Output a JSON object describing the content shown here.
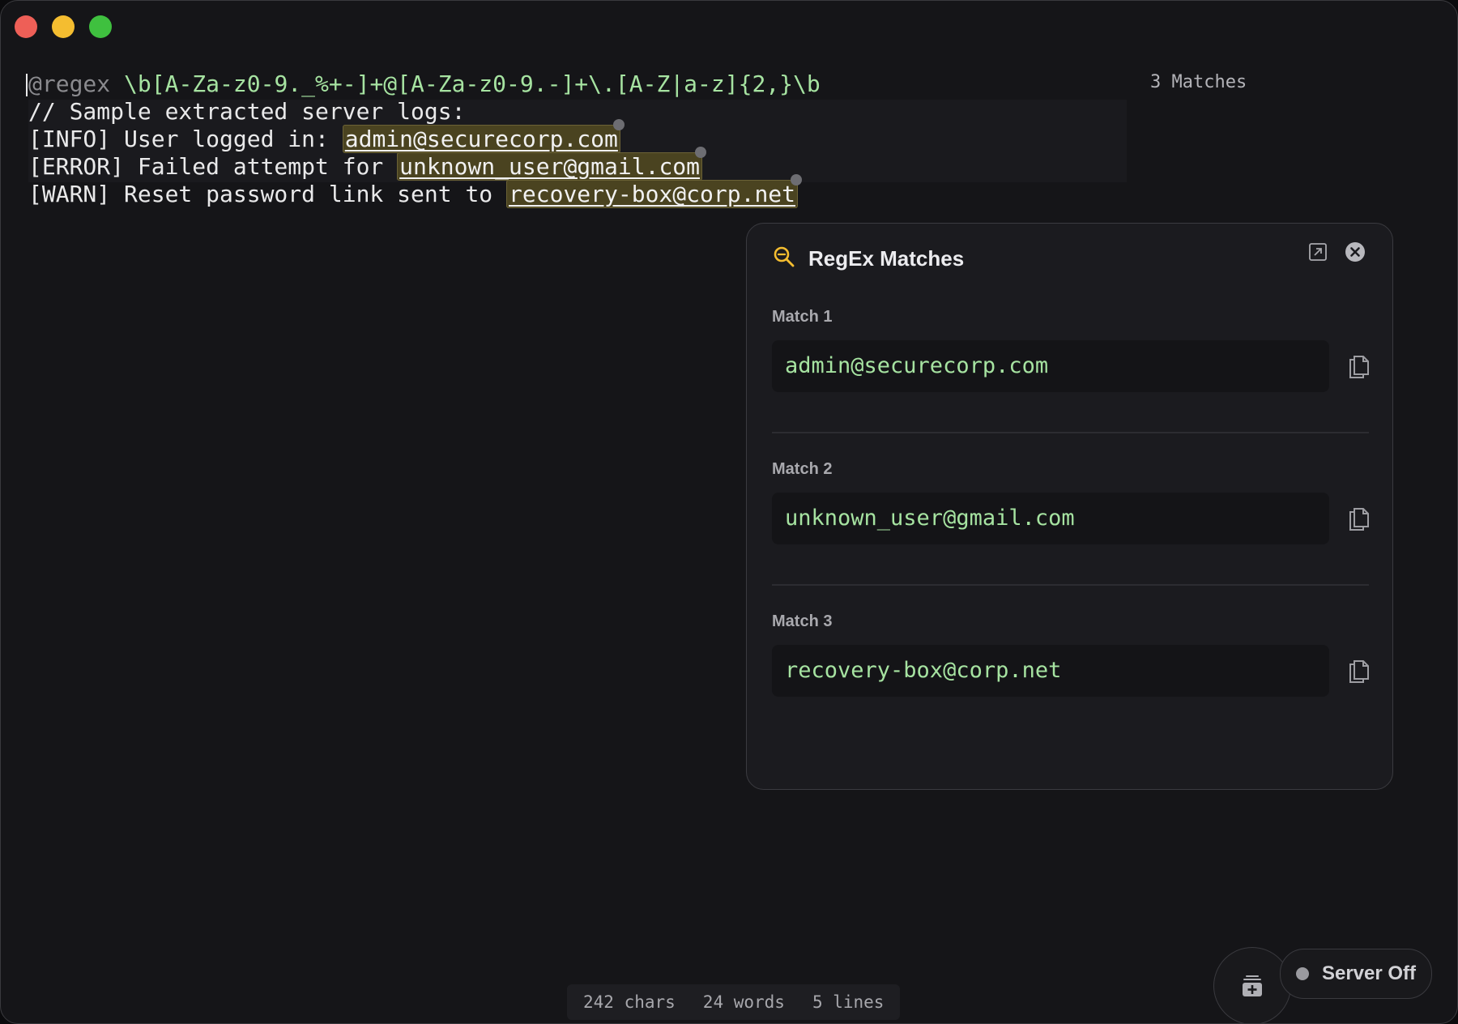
{
  "editor": {
    "directive": "@regex",
    "pattern": "\\b[A-Za-z0-9._%+-]+@[A-Za-z0-9.-]+\\.[A-Z|a-z]{2,}\\b",
    "comment": "// Sample extracted server logs:",
    "lines": [
      {
        "prefix": "[INFO] User logged in: ",
        "match": "admin@securecorp.com"
      },
      {
        "prefix": "[ERROR] Failed attempt for ",
        "match": "unknown_user@gmail.com"
      },
      {
        "prefix": "[WARN] Reset password link sent to ",
        "match": "recovery-box@corp.net"
      }
    ]
  },
  "match_count": "3 Matches",
  "panel": {
    "title": "RegEx Matches",
    "icon": "search-icon",
    "matches": [
      {
        "label": "Match 1",
        "value": "admin@securecorp.com"
      },
      {
        "label": "Match 2",
        "value": "unknown_user@gmail.com"
      },
      {
        "label": "Match 3",
        "value": "recovery-box@corp.net"
      }
    ]
  },
  "status": {
    "chars": "242 chars",
    "words": "24 words",
    "lines": "5 lines"
  },
  "server": {
    "label": "Server Off"
  },
  "colors": {
    "accent": "#f4bd30",
    "match_text": "#a6e3a1",
    "highlight": "#4a4320"
  }
}
